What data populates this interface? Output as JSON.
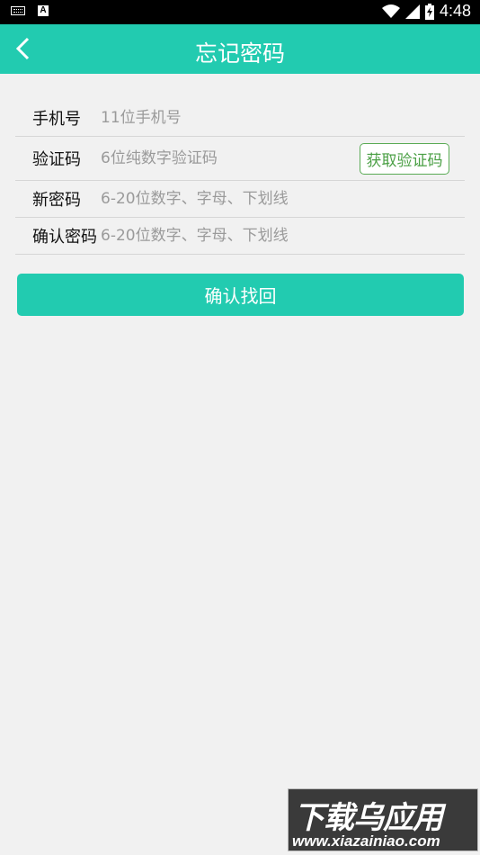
{
  "status_bar": {
    "time": "4:48",
    "icons": [
      "keyboard-icon",
      "a-icon",
      "wifi-icon",
      "signal-icon",
      "battery-charging-icon"
    ]
  },
  "app_bar": {
    "title": "忘记密码",
    "back_icon": "chevron-left-icon",
    "background": "#22cbb0"
  },
  "form": {
    "phone": {
      "label": "手机号",
      "placeholder": "11位手机号",
      "value": ""
    },
    "code": {
      "label": "验证码",
      "placeholder": "6位纯数字验证码",
      "value": "",
      "button_label": "获取验证码"
    },
    "new_password": {
      "label": "新密码",
      "placeholder": "6-20位数字、字母、下划线",
      "value": ""
    },
    "confirm_password": {
      "label": "确认密码",
      "placeholder": "6-20位数字、字母、下划线",
      "value": ""
    }
  },
  "submit": {
    "label": "确认找回"
  },
  "watermark": {
    "title": "下载乌应用",
    "url": "www.xiazainiao.com"
  },
  "colors": {
    "accent": "#22cbb0",
    "code_button": "#4a9f44",
    "background": "#f1f1f1"
  }
}
